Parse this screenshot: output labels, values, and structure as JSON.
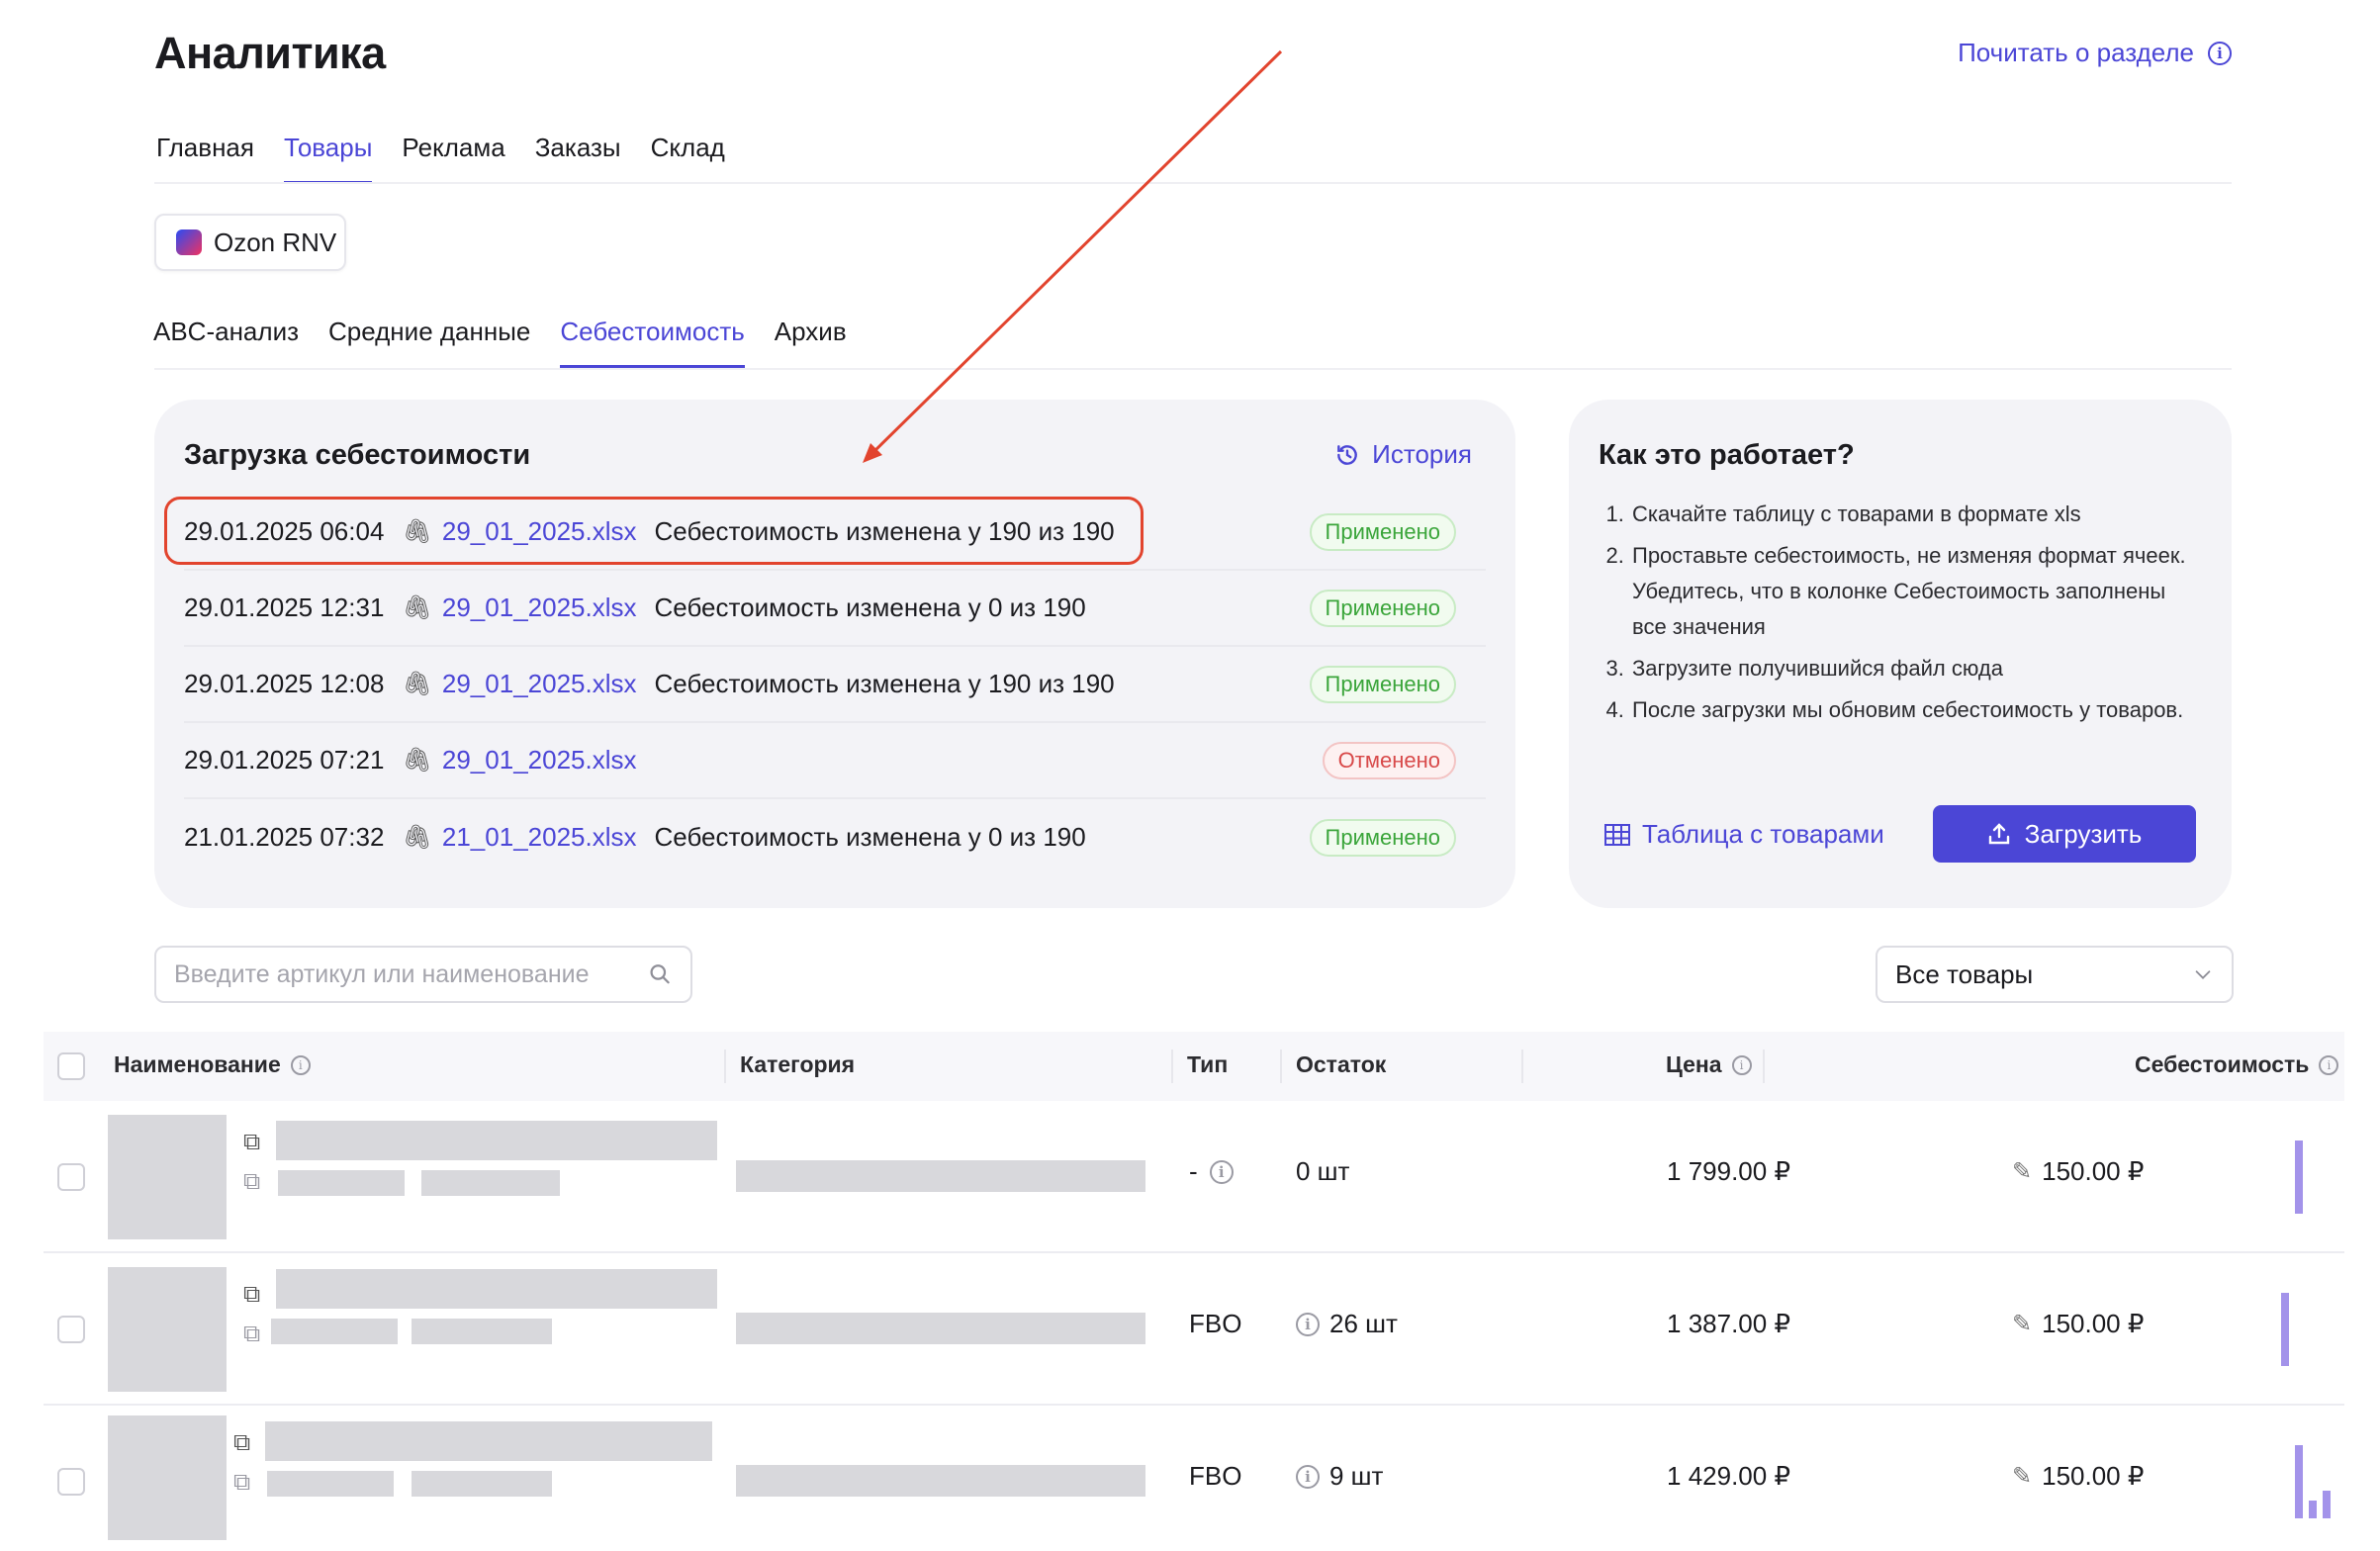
{
  "header": {
    "title": "Аналитика",
    "read_more": "Почитать о разделе"
  },
  "main_tabs": [
    {
      "label": "Главная",
      "active": false
    },
    {
      "label": "Товары",
      "active": true
    },
    {
      "label": "Реклама",
      "active": false
    },
    {
      "label": "Заказы",
      "active": false
    },
    {
      "label": "Склад",
      "active": false
    }
  ],
  "shop": {
    "name": "Ozon RNV"
  },
  "sub_tabs": [
    {
      "label": "ABC-анализ",
      "active": false
    },
    {
      "label": "Средние данные",
      "active": false
    },
    {
      "label": "Себестоимость",
      "active": true
    },
    {
      "label": "Архив",
      "active": false
    }
  ],
  "upload": {
    "title": "Загрузка себестоимости",
    "history_label": "История",
    "rows": [
      {
        "date": "29.01.2025 06:04",
        "file": "29_01_2025.xlsx",
        "message": "Себестоимость изменена у 190 из 190",
        "status": "Применено"
      },
      {
        "date": "29.01.2025 12:31",
        "file": "29_01_2025.xlsx",
        "message": "Себестоимость изменена у 0 из 190",
        "status": "Применено"
      },
      {
        "date": "29.01.2025 12:08",
        "file": "29_01_2025.xlsx",
        "message": "Себестоимость изменена у 190 из 190",
        "status": "Применено"
      },
      {
        "date": "29.01.2025 07:21",
        "file": "29_01_2025.xlsx",
        "message": "",
        "status": "Отменено"
      },
      {
        "date": "21.01.2025 07:32",
        "file": "21_01_2025.xlsx",
        "message": "Себестоимость изменена у 0 из 190",
        "status": "Применено"
      }
    ]
  },
  "how": {
    "title": "Как это работает?",
    "steps": [
      "Скачайте таблицу с товарами в формате xls",
      "Проставьте себестоимость, не изменяя формат ячеек. Убедитесь, что в колонке Себестоимость заполнены все значения",
      "Загрузите получившийся файл сюда",
      "После загрузки мы обновим себестоимость у товаров."
    ],
    "table_link": "Таблица с товарами",
    "upload_button": "Загрузить"
  },
  "filters": {
    "search_placeholder": "Введите артикул или наименование",
    "select_value": "Все товары"
  },
  "table": {
    "columns": {
      "name": "Наименование",
      "category": "Категория",
      "type": "Тип",
      "stock": "Остаток",
      "price": "Цена",
      "cost": "Себестоимость"
    },
    "rows": [
      {
        "type": "-",
        "stock": "0 шт",
        "price": "1 799.00 ₽",
        "cost": "150.00 ₽"
      },
      {
        "type": "FBO",
        "stock": "26 шт",
        "price": "1 387.00 ₽",
        "cost": "150.00 ₽"
      },
      {
        "type": "FBO",
        "stock": "9 шт",
        "price": "1 429.00 ₽",
        "cost": "150.00 ₽"
      }
    ]
  },
  "colors": {
    "accent": "#4b46d6",
    "annotation": "#e2442e",
    "ok": "#3aa53a",
    "cancel": "#d84a4a"
  }
}
